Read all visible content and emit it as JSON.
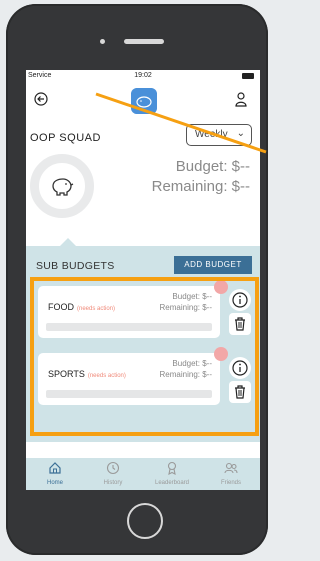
{
  "status_bar": {
    "signal": "Service",
    "time": "19:02"
  },
  "header": {
    "group_name": "OOP SQUAD",
    "period_select": "Weekly"
  },
  "summary": {
    "budget": "Budget: $--",
    "remaining": "Remaining: $--"
  },
  "sub_budgets": {
    "title": "SUB BUDGETS",
    "add_label": "ADD BUDGET",
    "items": [
      {
        "name": "FOOD",
        "tag": "(needs action)",
        "budget": "Budget: $--",
        "remaining": "Remaining: $--"
      },
      {
        "name": "SPORTS",
        "tag": "(needs action)",
        "budget": "Budget: $--",
        "remaining": "Remaining: $--"
      }
    ]
  },
  "tabs": [
    {
      "label": "Home",
      "icon": "home-icon",
      "active": true
    },
    {
      "label": "History",
      "icon": "clock-icon"
    },
    {
      "label": "Leaderboard",
      "icon": "award-icon"
    },
    {
      "label": "Friends",
      "icon": "users-icon"
    }
  ],
  "colors": {
    "accent": "#3b6f96",
    "panel": "#cfe3e7",
    "highlight": "#f6a012",
    "alert_dot": "#f2a7a7"
  }
}
